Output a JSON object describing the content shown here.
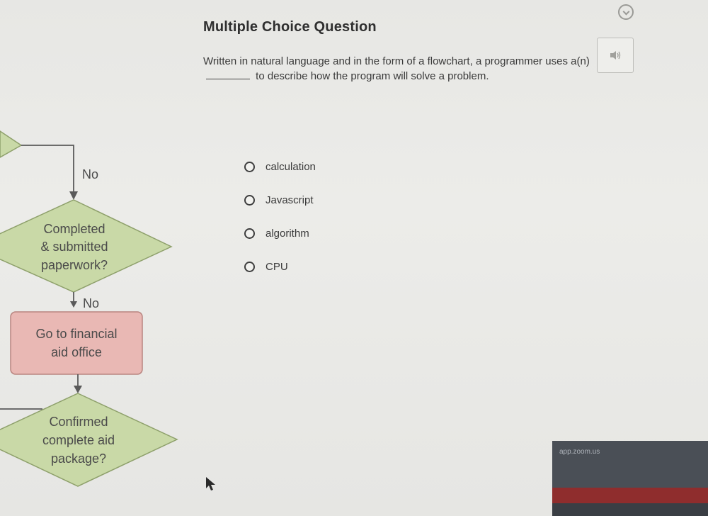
{
  "question": {
    "title": "Multiple Choice Question",
    "text_before_blank": "Written in natural language and in the form of a flowchart, a programmer uses a(n)",
    "text_after_blank": "to describe how the program will solve a problem."
  },
  "options": [
    {
      "label": "calculation",
      "selected": false
    },
    {
      "label": "Javascript",
      "selected": false
    },
    {
      "label": "algorithm",
      "selected": false
    },
    {
      "label": "CPU",
      "selected": false
    }
  ],
  "flowchart": {
    "branch_label_top": "No",
    "decision_1": [
      "Completed",
      "& submitted",
      "paperwork?"
    ],
    "branch_label_mid": "No",
    "process_1": [
      "Go to financial",
      "aid office"
    ],
    "decision_2": [
      "Confirmed",
      "complete aid",
      "package?"
    ]
  },
  "taskbar": {
    "label": "app.zoom.us"
  },
  "icons": {
    "top_right": "circle-check-icon",
    "audio": "speaker-icon",
    "cursor": "mouse-pointer-icon"
  },
  "colors": {
    "decision_fill": "#c9d9a7",
    "process_fill": "#e9b8b4",
    "accent_dark": "#2f2f2f"
  }
}
